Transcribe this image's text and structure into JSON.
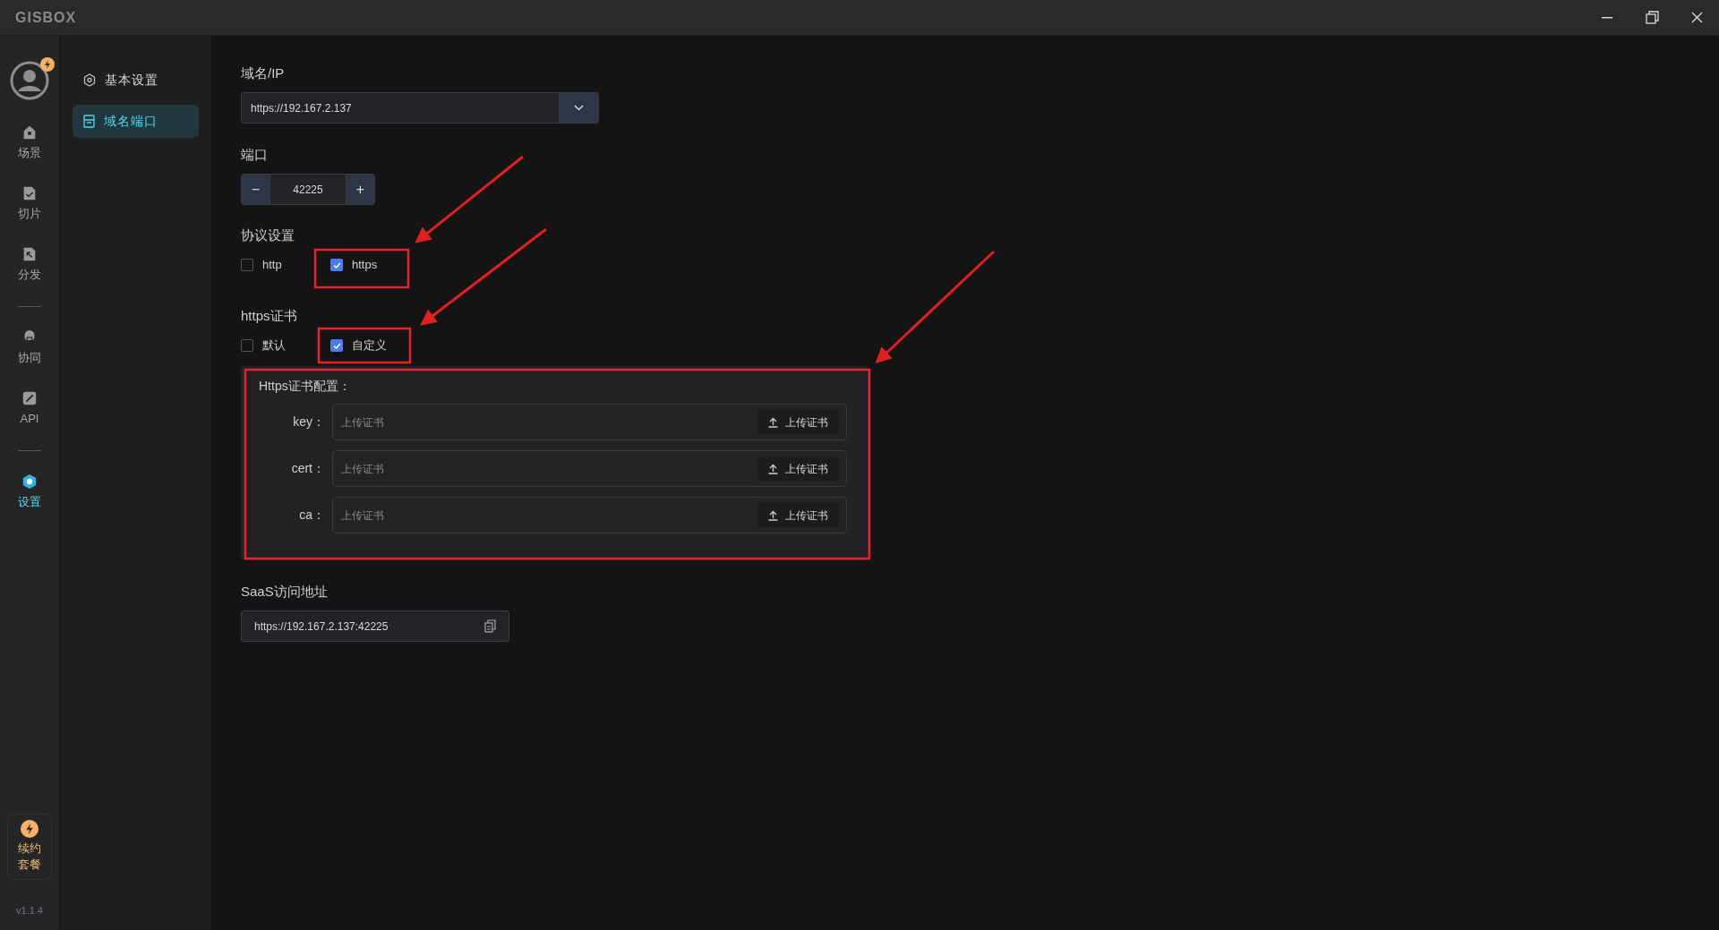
{
  "app": {
    "logo": "GISBOX",
    "version": "v1.1.4"
  },
  "nav_rail": {
    "groups": [
      [
        {
          "label": "场景",
          "selected": false
        },
        {
          "label": "切片",
          "selected": false
        },
        {
          "label": "分发",
          "selected": false
        }
      ],
      [
        {
          "label": "协同",
          "selected": false
        },
        {
          "label": "API",
          "selected": false
        }
      ],
      [
        {
          "label": "设置",
          "selected": true
        }
      ]
    ],
    "renew": "续约套餐"
  },
  "settings_menu": {
    "items": [
      {
        "label": "基本设置",
        "selected": false
      },
      {
        "label": "域名端口",
        "selected": true
      }
    ]
  },
  "form": {
    "domain": {
      "label": "域名/IP",
      "value": "https://192.167.2.137"
    },
    "port": {
      "label": "端口",
      "value": "42225",
      "minus": "−",
      "plus": "+"
    },
    "protocol": {
      "label": "协议设置",
      "options": [
        {
          "label": "http",
          "checked": false
        },
        {
          "label": "https",
          "checked": true
        }
      ]
    },
    "certificate": {
      "label": "https证书",
      "options": [
        {
          "label": "默认",
          "checked": false
        },
        {
          "label": "自定义",
          "checked": true
        }
      ]
    },
    "cert_config": {
      "title": "Https证书配置：",
      "rows": [
        {
          "label": "key：",
          "placeholder": "上传证书",
          "button": "上传证书"
        },
        {
          "label": "cert：",
          "placeholder": "上传证书",
          "button": "上传证书"
        },
        {
          "label": "ca：",
          "placeholder": "上传证书",
          "button": "上传证书"
        }
      ]
    },
    "saas": {
      "label": "SaaS访问地址",
      "value": "https://192.167.2.137:42225"
    }
  }
}
